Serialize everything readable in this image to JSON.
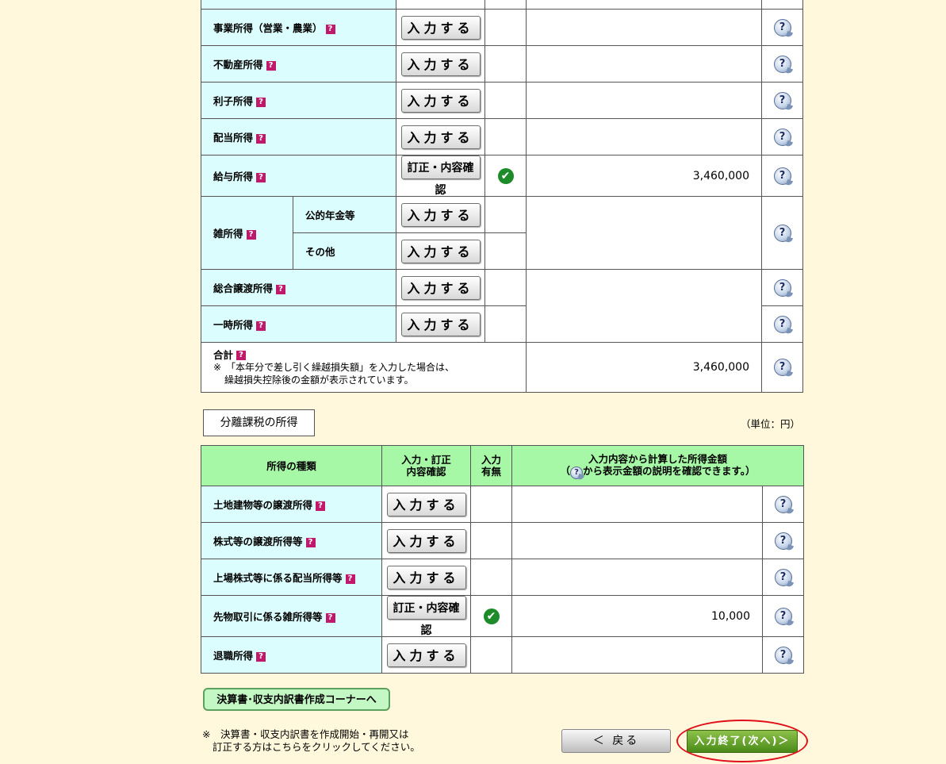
{
  "colors": {
    "page_bg": "#fff8dc",
    "label_cell_bg": "#dcfdfd",
    "header_bg": "#a6f7a6",
    "qmark_bg": "#c0186a",
    "check_green": "#1e8b2a",
    "next_button_green": "#4a8a18",
    "highlight_red": "#e0101a"
  },
  "icons": {
    "qmark": "?",
    "help": "?",
    "check": "✔"
  },
  "general_income": {
    "rows": [
      {
        "label": "事業所得（営業・農業）",
        "button": "入力する",
        "amount": ""
      },
      {
        "label": "不動産所得",
        "button": "入力する",
        "amount": ""
      },
      {
        "label": "利子所得",
        "button": "入力する",
        "amount": ""
      },
      {
        "label": "配当所得",
        "button": "入力する",
        "amount": ""
      },
      {
        "label": "給与所得",
        "button": "訂正・内容確認",
        "amount": "3,460,000",
        "checked": true
      }
    ],
    "misc": {
      "label": "雑所得",
      "sub1": {
        "label": "公的年金等",
        "button": "入力する"
      },
      "sub2": {
        "label": "その他",
        "button": "入力する"
      }
    },
    "rows2": [
      {
        "label": "総合譲渡所得",
        "button": "入力する"
      },
      {
        "label": "一時所得",
        "button": "入力する"
      }
    ],
    "total": {
      "label": "合計",
      "note_line1": "※　「本年分で差し引く繰越損失額」を入力した場合は、",
      "note_line2": "繰越損失控除後の金額が表示されています。",
      "amount": "3,460,000"
    }
  },
  "separate": {
    "tab_label": "分離課税の所得",
    "unit": "（単位：円）",
    "headers": {
      "type": "所得の種類",
      "input_line1": "入力・訂正",
      "input_line2": "内容確認",
      "has_line1": "入力",
      "has_line2": "有無",
      "amount_line1": "入力内容から計算した所得金額",
      "amount_line2_pre": "（",
      "amount_line2_post": "から表示金額の説明を確認できます。）"
    },
    "rows": [
      {
        "label": "土地建物等の譲渡所得",
        "button": "入力する",
        "amount": ""
      },
      {
        "label": "株式等の譲渡所得等",
        "button": "入力する",
        "amount": ""
      },
      {
        "label": "上場株式等に係る配当所得等",
        "button": "入力する",
        "amount": ""
      },
      {
        "label": "先物取引に係る雑所得等",
        "button": "訂正・内容確認",
        "amount": "10,000",
        "checked": true
      },
      {
        "label": "退職所得",
        "button": "入力する",
        "amount": ""
      }
    ]
  },
  "footer": {
    "settlement_button": "決算書･収支内訳書作成コーナーへ",
    "note_line1": "※　決算書・収支内訳書を作成開始・再開又は",
    "note_line2": "訂正する方はこちらをクリックしてください。",
    "back_button": "＜ 戻る",
    "next_button": "入力終了(次へ)＞"
  }
}
